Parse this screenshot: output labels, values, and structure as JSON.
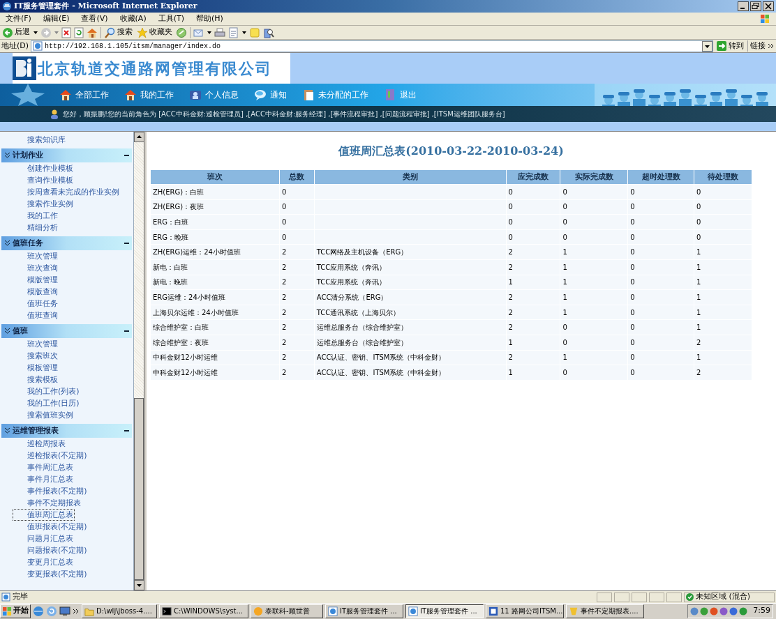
{
  "browser": {
    "title": "IT服务管理套件 - Microsoft Internet Explorer",
    "menu": [
      "文件(F)",
      "编辑(E)",
      "查看(V)",
      "收藏(A)",
      "工具(T)",
      "帮助(H)"
    ],
    "toolbar": [
      "后退",
      "搜索",
      "收藏夹"
    ],
    "address_label": "地址(D)",
    "url": "http://192.168.1.105/itsm/manager/index.do",
    "go": "转到",
    "links": "链接"
  },
  "banner": {
    "company": "北京轨道交通路网管理有限公司",
    "nav": [
      "全部工作",
      "我的工作",
      "个人信息",
      "通知",
      "未分配的工作",
      "退出"
    ],
    "greeting": "您好，顾振鹏!您的当前角色为 [ACC中科金财:巡检管理员] ,[ACC中科金财:服务经理] ,[事件流程审批] ,[问题流程审批] ,[ITSM运维团队服务台]"
  },
  "sidebar": {
    "items": [
      {
        "label": "搜索知识库",
        "selected": false
      }
    ],
    "sections": [
      {
        "title": "计划作业",
        "expanded": true,
        "items": [
          {
            "label": "创建作业模板",
            "selected": false
          },
          {
            "label": "查询作业模板",
            "selected": false
          },
          {
            "label": "按周查看未完成的作业实例",
            "selected": false
          },
          {
            "label": "搜索作业实例",
            "selected": false
          },
          {
            "label": "我的工作",
            "selected": false
          },
          {
            "label": "精细分析",
            "selected": false
          }
        ]
      },
      {
        "title": "值班任务",
        "expanded": true,
        "items": [
          {
            "label": "班次管理",
            "selected": false
          },
          {
            "label": "班次查询",
            "selected": false
          },
          {
            "label": "模版管理",
            "selected": false
          },
          {
            "label": "模版查询",
            "selected": false
          },
          {
            "label": "值班任务",
            "selected": false
          },
          {
            "label": "值班查询",
            "selected": false
          }
        ]
      },
      {
        "title": "值班",
        "expanded": true,
        "items": [
          {
            "label": "班次管理",
            "selected": false
          },
          {
            "label": "搜索班次",
            "selected": false
          },
          {
            "label": "模板管理",
            "selected": false
          },
          {
            "label": "搜索模板",
            "selected": false
          },
          {
            "label": "我的工作(列表)",
            "selected": false
          },
          {
            "label": "我的工作(日历)",
            "selected": false
          },
          {
            "label": "搜索值班实例",
            "selected": false
          }
        ]
      },
      {
        "title": "运维管理报表",
        "expanded": true,
        "items": [
          {
            "label": "巡检周报表",
            "selected": false
          },
          {
            "label": "巡检报表(不定期)",
            "selected": false
          },
          {
            "label": "事件周汇总表",
            "selected": false
          },
          {
            "label": "事件月汇总表",
            "selected": false
          },
          {
            "label": "事件报表(不定期)",
            "selected": false
          },
          {
            "label": "事件不定期报表",
            "selected": false
          },
          {
            "label": "值班周汇总表",
            "selected": true
          },
          {
            "label": "值班报表(不定期)",
            "selected": false
          },
          {
            "label": "问题月汇总表",
            "selected": false
          },
          {
            "label": "问题报表(不定期)",
            "selected": false
          },
          {
            "label": "变更月汇总表",
            "selected": false
          },
          {
            "label": "变更报表(不定期)",
            "selected": false
          }
        ]
      }
    ]
  },
  "report": {
    "title": "值班周汇总表(2010-03-22-2010-03-24)",
    "columns": [
      "班次",
      "总数",
      "类别",
      "应完成数",
      "实际完成数",
      "超时处理数",
      "待处理数"
    ],
    "rows": [
      [
        "ZH(ERG)：白班",
        "0",
        "",
        "0",
        "0",
        "0",
        "0"
      ],
      [
        "ZH(ERG)：夜班",
        "0",
        "",
        "0",
        "0",
        "0",
        "0"
      ],
      [
        "ERG：白班",
        "0",
        "",
        "0",
        "0",
        "0",
        "0"
      ],
      [
        "ERG：晚班",
        "0",
        "",
        "0",
        "0",
        "0",
        "0"
      ],
      [
        "ZH(ERG)运维：24小时值班",
        "2",
        "TCC网络及主机设备（ERG）",
        "2",
        "1",
        "0",
        "1"
      ],
      [
        "新电：白班",
        "2",
        "TCC应用系统（奔讯）",
        "2",
        "1",
        "0",
        "1"
      ],
      [
        "新电：晚班",
        "2",
        "TCC应用系统（奔讯）",
        "1",
        "1",
        "0",
        "1"
      ],
      [
        "ERG运维：24小时值班",
        "2",
        "ACC清分系统（ERG）",
        "2",
        "1",
        "0",
        "1"
      ],
      [
        "上海贝尔运维：24小时值班",
        "2",
        "TCC通讯系统（上海贝尔）",
        "2",
        "1",
        "0",
        "1"
      ],
      [
        "综合维护室：白班",
        "2",
        "运维总服务台（综合维护室）",
        "2",
        "0",
        "0",
        "1"
      ],
      [
        "综合维护室：夜班",
        "2",
        "运维总服务台（综合维护室）",
        "1",
        "0",
        "0",
        "2"
      ],
      [
        "中科金财12小时运维",
        "2",
        "ACC认证、密钥、ITSM系统（中科金财）",
        "2",
        "1",
        "0",
        "1"
      ],
      [
        "中科金财12小时运维",
        "2",
        "ACC认证、密钥、ITSM系统（中科金财）",
        "1",
        "0",
        "0",
        "2"
      ]
    ]
  },
  "status_bar": {
    "text": "完毕",
    "zone": "未知区域 (混合)"
  },
  "taskbar": {
    "start": "开始",
    "tasks": [
      {
        "label": "D:\\wlj\\jboss-4....",
        "selected": false
      },
      {
        "label": "C:\\WINDOWS\\syst...",
        "selected": false
      },
      {
        "label": "泰联科-顾世普",
        "selected": false
      },
      {
        "label": "IT服务管理套件 ...",
        "selected": false
      },
      {
        "label": "IT服务管理套件 ...",
        "selected": true
      },
      {
        "label": "11 路网公司ITSM...",
        "selected": false
      },
      {
        "label": "事件不定期报表....",
        "selected": false
      }
    ],
    "time": "7:59"
  }
}
